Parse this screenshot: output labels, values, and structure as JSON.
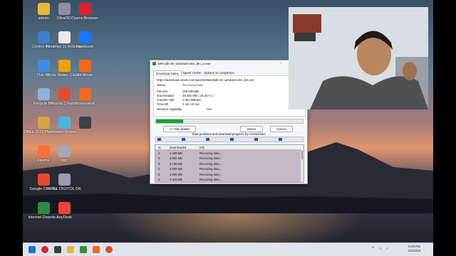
{
  "desktop": {
    "icons": [
      {
        "label": "admin",
        "color": "#e8b93a"
      },
      {
        "label": "UltraISO",
        "color": "#8f8fa0"
      },
      {
        "label": "Opera Browser",
        "color": "#d8242b"
      },
      {
        "label": "Control Panel",
        "color": "#3d7fd1"
      },
      {
        "label": "Windows 11 Activator",
        "color": "#e9e9e9"
      },
      {
        "label": "Facebook",
        "color": "#1877f2"
      },
      {
        "label": "This PC",
        "color": "#3a8ee6"
      },
      {
        "label": "Movie Maker Classic",
        "color": "#f5a000"
      },
      {
        "label": "3D Mover",
        "color": "#f26a1b"
      },
      {
        "label": "Recycle Bin",
        "color": "#8fb3d8"
      },
      {
        "label": "Mozilla Chrome",
        "color": "#e64a2e"
      },
      {
        "label": "Screenshot",
        "color": "#f06a24"
      },
      {
        "label": "Office 2021 ProPlus ...",
        "color": "#d6a44a"
      },
      {
        "label": "Icecream Screen ...",
        "color": "#4ab3e6"
      },
      {
        "label": "",
        "color": "#3b3f4a"
      },
      {
        "label": "Firefox",
        "color": "#ff7139"
      },
      {
        "label": "old",
        "color": "#a7a7b8"
      },
      {
        "label": "Google Chrome",
        "color": "#e64a2e"
      },
      {
        "label": "INTEL DIGITOL OK",
        "color": "#9b9bb0"
      },
      {
        "label": "Internet Downlo...",
        "color": "#2e8a3e"
      },
      {
        "label": "AnyDesk",
        "color": "#ef443b"
      }
    ]
  },
  "dialog": {
    "title": "18% jdk-19_windows-x64_bin_2.exe",
    "tabs": [
      "Download status",
      "Speed Limiter",
      "Options on completion"
    ],
    "url": "https://download.oracle.com/java/19/latest/jdk-19_windows-x64_bin.exe",
    "status_label": "Status",
    "status_value": "Receiving data...",
    "fields": [
      {
        "label": "File size",
        "value": "158.909 MB"
      },
      {
        "label": "Downloaded",
        "value": "29.284 MB  ( 18.42 % )"
      },
      {
        "label": "Transfer rate",
        "value": "1.051 MB/sec"
      },
      {
        "label": "Time left",
        "value": "2 min 10 sec"
      },
      {
        "label": "Resume capability",
        "value": "Yes"
      }
    ],
    "progress_percent": 18.42,
    "hide_details_label": "<< Hide details",
    "pause_label": "Pause",
    "cancel_label": "Cancel",
    "connections_label": "Start positions and download progress by connections",
    "table_headers": [
      "N.",
      "Downloaded",
      "Info"
    ],
    "connections": [
      {
        "n": "1",
        "downloaded": "4.499 MB",
        "info": "Receiving data..."
      },
      {
        "n": "2",
        "downloaded": "3.662 MB",
        "info": "Receiving data..."
      },
      {
        "n": "3",
        "downloaded": "3.729 MB",
        "info": "Receiving data..."
      },
      {
        "n": "4",
        "downloaded": "3.589 MB",
        "info": "Receiving data..."
      },
      {
        "n": "5",
        "downloaded": "3.390 MB",
        "info": "Receiving data..."
      },
      {
        "n": "6",
        "downloaded": "3.419 MB",
        "info": "Receiving data..."
      }
    ]
  },
  "taskbar": {
    "time": "6:28 PM",
    "date": "1/2/2023"
  }
}
